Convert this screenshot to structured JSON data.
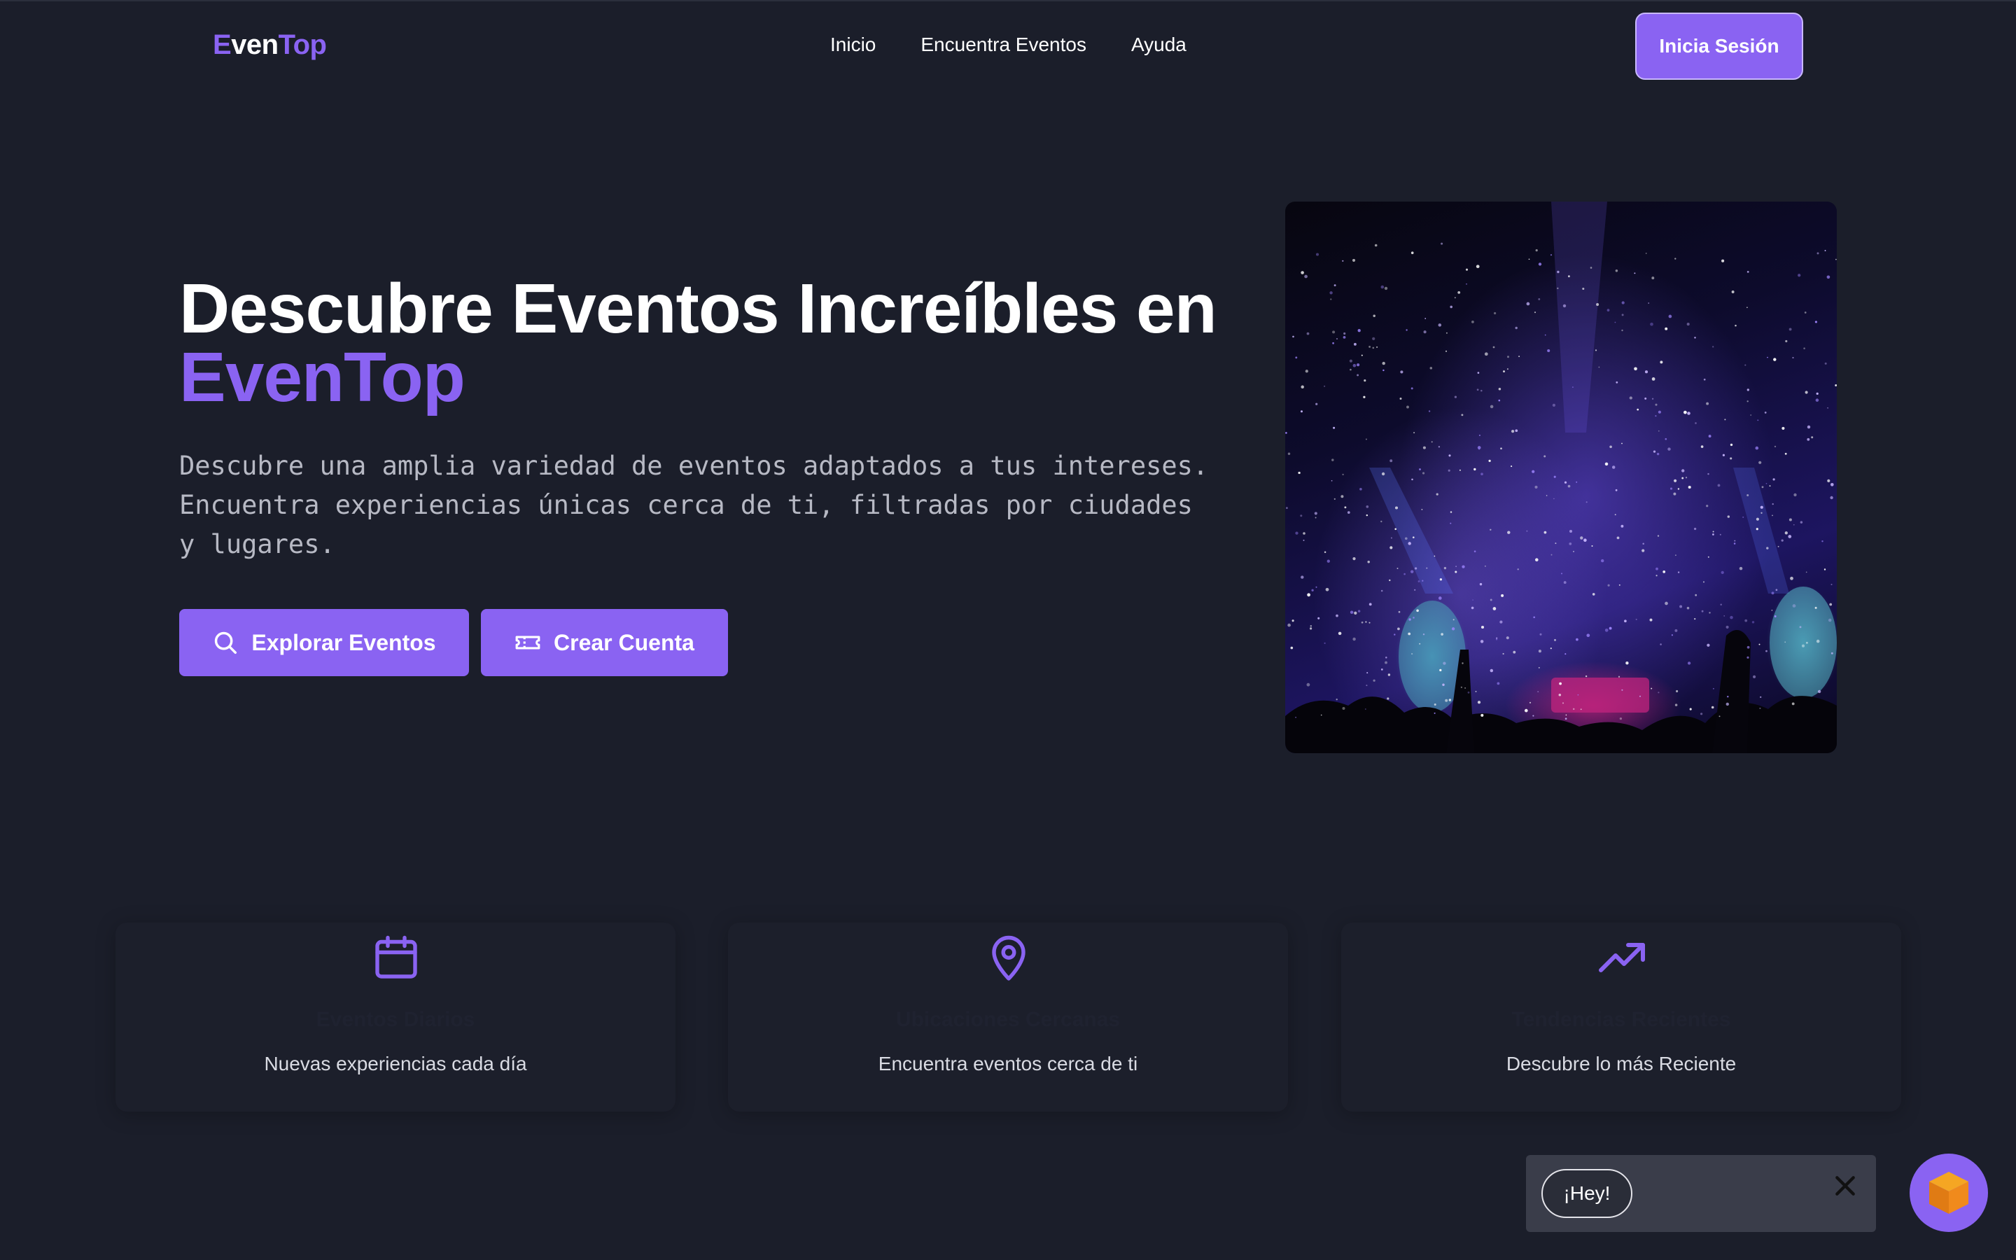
{
  "header": {
    "logo_part1": "E",
    "logo_part2": "ven",
    "logo_part3": "Top",
    "nav": [
      "Inicio",
      "Encuentra Eventos",
      "Ayuda"
    ],
    "login_label": "Inicia Sesión"
  },
  "hero": {
    "title_line1": "Descubre Eventos Increíbles en",
    "title_accent": "EvenTop",
    "description": "Descubre una amplia variedad de eventos adaptados a tus intereses. Encuentra experiencias únicas cerca de ti, filtradas por ciudades y lugares.",
    "explore_label": "Explorar Eventos",
    "create_label": "Crear Cuenta",
    "image_icon": "concert-photo"
  },
  "features": [
    {
      "icon": "calendar-icon",
      "title": "Eventos Diarios",
      "description": "Nuevas experiencias cada día"
    },
    {
      "icon": "map-pin-icon",
      "title": "Ubicaciones Cercanas",
      "description": "Encuentra eventos cerca de ti"
    },
    {
      "icon": "trending-up-icon",
      "title": "Tendencias Recientes",
      "description": "Descubre lo más Reciente"
    }
  ],
  "chat": {
    "greeting": "¡Hey!",
    "close_icon": "close-icon",
    "launcher_icon": "cube-icon"
  },
  "colors": {
    "background": "#1b1e2a",
    "accent": "#8a63f2",
    "muted_text": "#b7b9c4"
  }
}
